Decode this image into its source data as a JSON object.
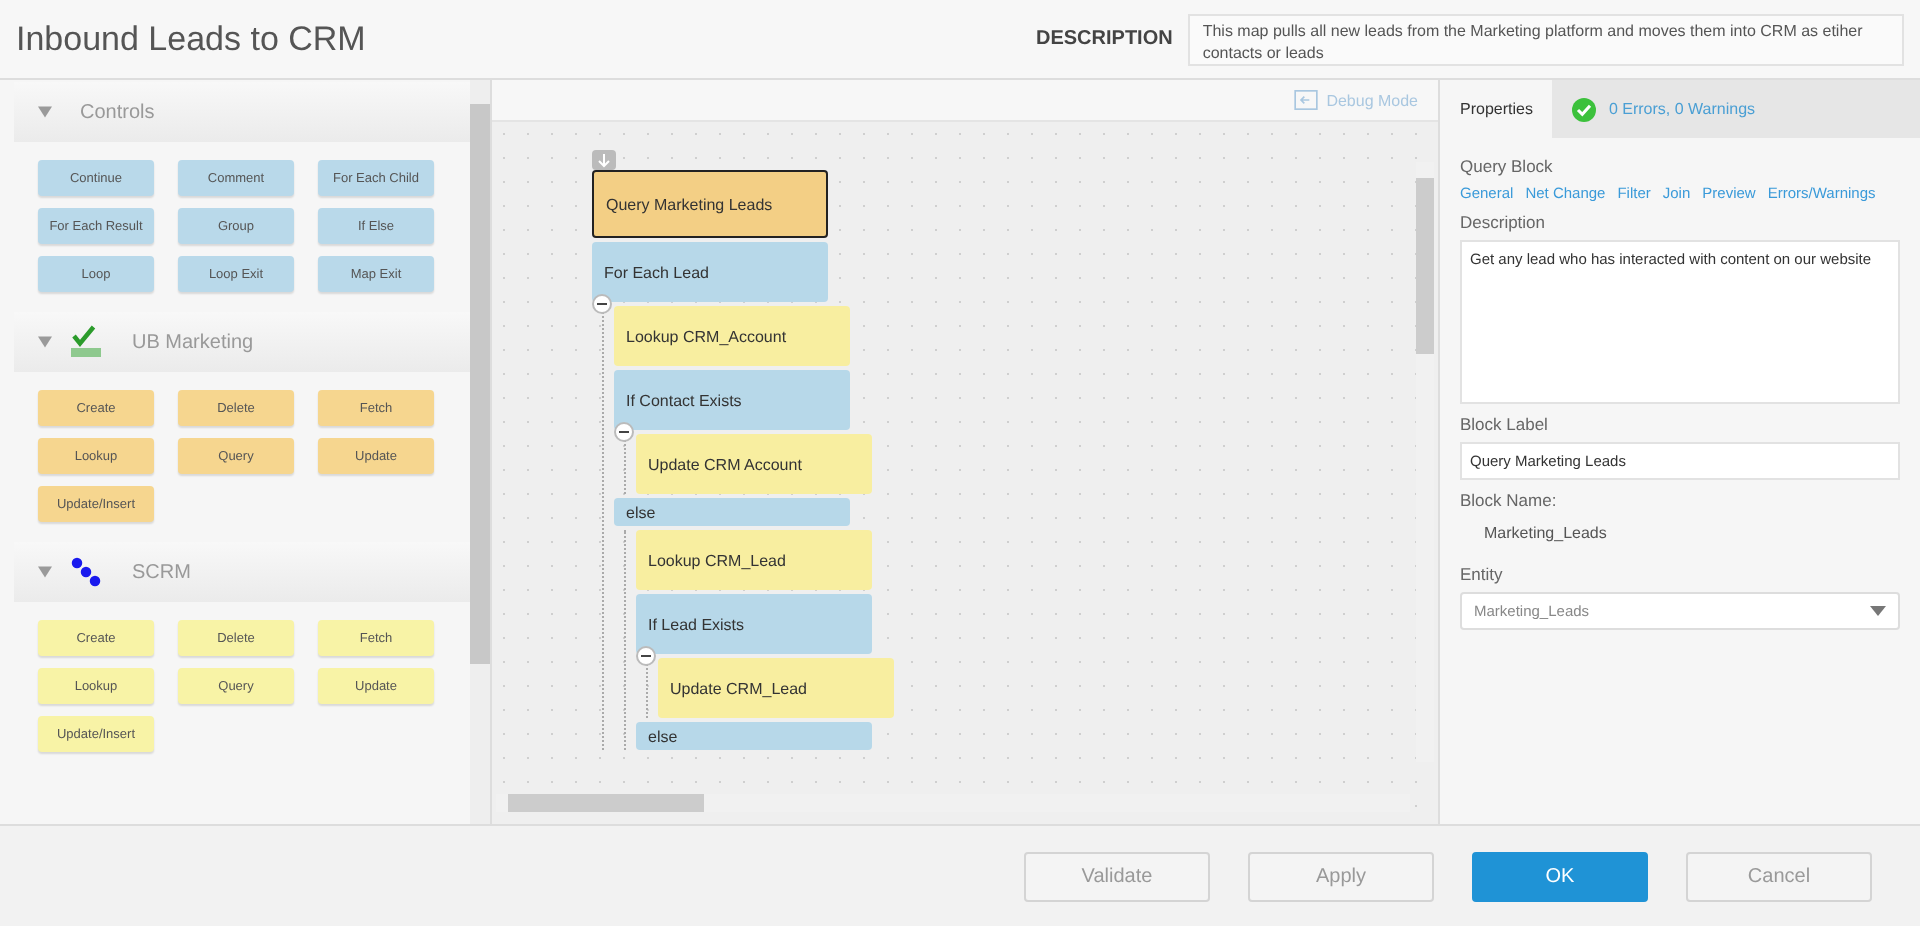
{
  "window": {
    "title": "Inbound Leads to CRM"
  },
  "description": {
    "label": "DESCRIPTION",
    "text": "This map pulls all new leads from the Marketing platform and moves them into CRM as etiher contacts or leads"
  },
  "palette": {
    "sections": [
      {
        "title": "Controls",
        "kind": "controls",
        "expanded": true,
        "blocks": [
          "Continue",
          "Comment",
          "For Each Child",
          "For Each Result",
          "Group",
          "If Else",
          "Loop",
          "Loop Exit",
          "Map Exit"
        ]
      },
      {
        "title": "UB Marketing",
        "kind": "marketing",
        "expanded": true,
        "blocks": [
          "Create",
          "Delete",
          "Fetch",
          "Lookup",
          "Query",
          "Update",
          "Update/Insert"
        ]
      },
      {
        "title": "SCRM",
        "kind": "crm",
        "expanded": true,
        "blocks": [
          "Create",
          "Delete",
          "Fetch",
          "Lookup",
          "Query",
          "Update",
          "Update/Insert"
        ]
      }
    ]
  },
  "canvas": {
    "debug_mode": "Debug Mode",
    "blocks": [
      {
        "label": "Query Marketing Leads",
        "kind": "query",
        "selected": true
      },
      {
        "label": "For Each Lead",
        "kind": "control",
        "selected": false,
        "expanded": true,
        "children": [
          {
            "label": "Lookup CRM_Account",
            "kind": "action",
            "selected": false
          },
          {
            "label": "If Contact Exists",
            "kind": "control",
            "selected": false,
            "expanded": true,
            "children": [
              {
                "label": "Update CRM Account",
                "kind": "action",
                "selected": false
              }
            ]
          },
          {
            "label": "else",
            "kind": "branch",
            "selected": false,
            "children": [
              {
                "label": "Lookup CRM_Lead",
                "kind": "action",
                "selected": false
              },
              {
                "label": "If Lead Exists",
                "kind": "control",
                "selected": false,
                "expanded": true,
                "children": [
                  {
                    "label": "Update CRM_Lead",
                    "kind": "action",
                    "selected": false
                  }
                ]
              },
              {
                "label": "else",
                "kind": "branch",
                "selected": false
              }
            ]
          }
        ]
      }
    ]
  },
  "properties": {
    "tabs": [
      {
        "label": "Properties",
        "selected": true
      },
      {
        "label": "0 Errors, 0 Warnings",
        "selected": false
      }
    ],
    "heading": "Query Block",
    "links": [
      "General",
      "Net Change",
      "Filter",
      "Join",
      "Preview",
      "Errors/Warnings"
    ],
    "description_label": "Description",
    "description": "Get any lead who has interacted with content on our website",
    "block_label_label": "Block Label",
    "block_label": "Query Marketing Leads",
    "block_name_label": "Block Name:",
    "block_name": "Marketing_Leads",
    "entity_label": "Entity",
    "entity": "Marketing_Leads"
  },
  "buttons": [
    {
      "label": "Validate",
      "kind": "default"
    },
    {
      "label": "Apply",
      "kind": "default"
    },
    {
      "label": "OK",
      "kind": "primary"
    },
    {
      "label": "Cancel",
      "kind": "default"
    }
  ]
}
